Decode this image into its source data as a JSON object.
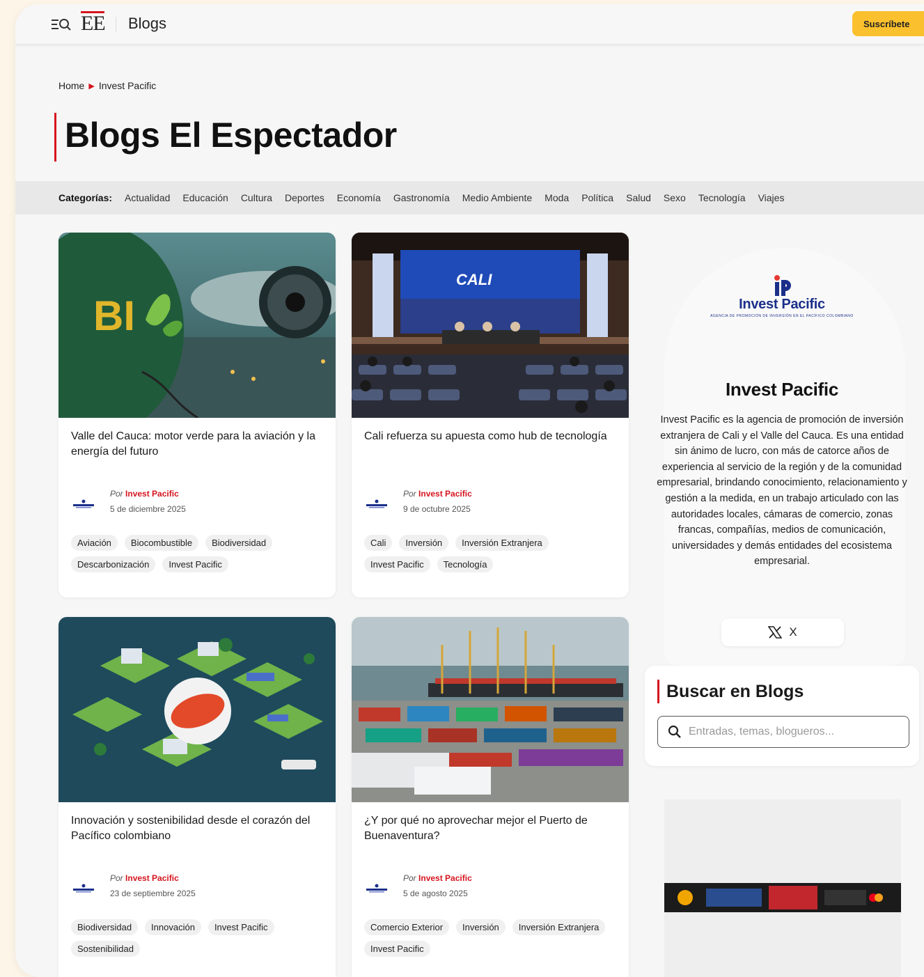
{
  "header": {
    "logo_text": "EE",
    "section": "Blogs",
    "subscribe_label": "Suscríbete"
  },
  "breadcrumb": {
    "home": "Home",
    "current": "Invest Pacific"
  },
  "page_title": "Blogs El Espectador",
  "categories": {
    "label": "Categorías:",
    "items": [
      "Actualidad",
      "Educación",
      "Cultura",
      "Deportes",
      "Economía",
      "Gastronomía",
      "Medio Ambiente",
      "Moda",
      "Política",
      "Salud",
      "Sexo",
      "Tecnología",
      "Viajes"
    ]
  },
  "posts": [
    {
      "title": "Valle del Cauca: motor verde para la aviación y la energía del futuro",
      "by": "Por",
      "author": "Invest Pacific",
      "date": "5 de diciembre 2025",
      "tags": [
        "Aviación",
        "Biocombustible",
        "Biodiversidad",
        "Descarbonización",
        "Invest Pacific"
      ],
      "image": "bio-jet-image"
    },
    {
      "title": "Cali refuerza su apuesta como hub de tecnología",
      "by": "Por",
      "author": "Invest Pacific",
      "date": "9 de octubre 2025",
      "tags": [
        "Cali",
        "Inversión",
        "Inversión Extranjera",
        "Invest Pacific",
        "Tecnología"
      ],
      "image": "conference-image",
      "image_text": "CALI"
    },
    {
      "title": "Innovación y sostenibilidad desde el corazón del Pacífico colombiano",
      "by": "Por",
      "author": "Invest Pacific",
      "date": "23 de septiembre 2025",
      "tags": [
        "Biodiversidad",
        "Innovación",
        "Invest Pacific",
        "Sostenibilidad"
      ],
      "image": "isometric-infographic-image"
    },
    {
      "title": "¿Y por qué no aprovechar mejor el Puerto de Buenaventura?",
      "by": "Por",
      "author": "Invest Pacific",
      "date": "5 de agosto 2025",
      "tags": [
        "Comercio Exterior",
        "Inversión",
        "Inversión Extranjera",
        "Invest Pacific"
      ],
      "image": "port-containers-image"
    }
  ],
  "profile": {
    "logo_word": "Invest Pacific",
    "logo_sub": "AGENCIA DE PROMOCIÓN DE INVERSIÓN EN EL PACÍFICO COLOMBIANO",
    "name": "Invest Pacific",
    "bio": "Invest Pacific es la agencia de promoción de inversión extranjera de Cali y el Valle del Cauca. Es una entidad sin ánimo de lucro, con más de catorce años de experiencia al servicio de la región y de la comunidad empresarial, brindando conocimiento, relacionamiento y gestión a la medida, en un trabajo articulado con las autoridades locales, cámaras de comercio, zonas francas, compañías, medios de comunicación, universidades y demás entidades del ecosistema empresarial.",
    "social_label": "X"
  },
  "search": {
    "title": "Buscar en Blogs",
    "placeholder": "Entradas, temas, blogueros..."
  },
  "colors": {
    "accent": "#d6141e",
    "subscribe": "#fbc02d",
    "brand_blue": "#1b2f8a"
  }
}
